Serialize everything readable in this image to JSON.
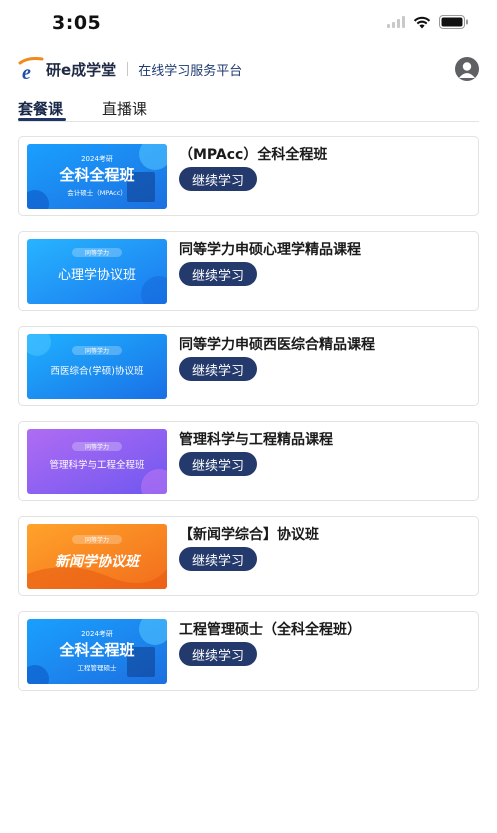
{
  "status_bar": {
    "time": "3:05"
  },
  "header": {
    "logo_text": "研e成学堂",
    "slogan": "在线学习服务平台"
  },
  "tabs": [
    {
      "label": "套餐课",
      "active": true
    },
    {
      "label": "直播课",
      "active": false
    }
  ],
  "courses": [
    {
      "title": "（MPAcc）全科全程班",
      "button": "继续学习",
      "thumb": {
        "year": "2024考研",
        "main": "全科全程班",
        "sub": "会计硕士（MPAcc）"
      }
    },
    {
      "title": "同等学力申硕心理学精品课程",
      "button": "继续学习",
      "thumb": {
        "year": "同等学力",
        "main": "心理学协议班",
        "sub": ""
      }
    },
    {
      "title": "同等学力申硕西医综合精品课程",
      "button": "继续学习",
      "thumb": {
        "year": "同等学力",
        "main": "西医综合(学硕)协议班",
        "sub": ""
      }
    },
    {
      "title": "管理科学与工程精品课程",
      "button": "继续学习",
      "thumb": {
        "year": "同等学力",
        "main": "管理科学与工程全程班",
        "sub": ""
      }
    },
    {
      "title": "【新闻学综合】协议班",
      "button": "继续学习",
      "thumb": {
        "year": "同等学力",
        "main": "新闻学协议班",
        "sub": ""
      }
    },
    {
      "title": "工程管理硕士（全科全程班）",
      "button": "继续学习",
      "thumb": {
        "year": "2024考研",
        "main": "全科全程班",
        "sub": "工程管理硕士"
      }
    }
  ],
  "colors": {
    "primary": "#243a6c",
    "card_border": "#e2e2e2",
    "blue_thumb": "#1f8ef0",
    "purple_thumb": "#8b5ff0",
    "orange_thumb": "#f58a1f"
  }
}
